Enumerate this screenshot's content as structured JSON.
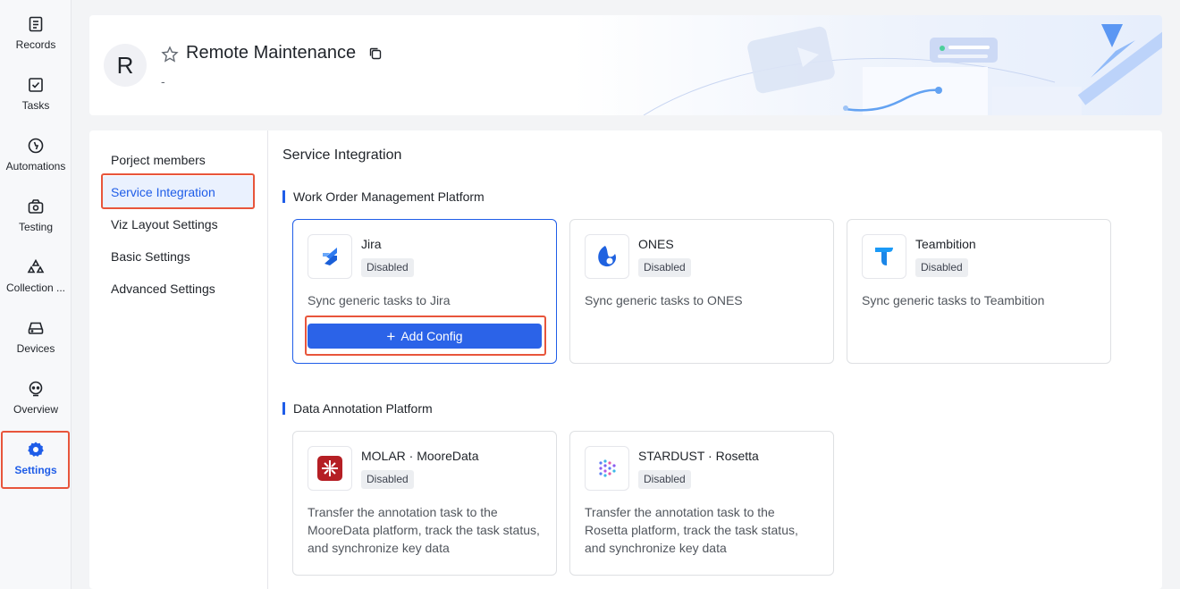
{
  "rail": {
    "items": [
      {
        "label": "Records",
        "icon": "records-icon"
      },
      {
        "label": "Tasks",
        "icon": "tasks-icon"
      },
      {
        "label": "Automations",
        "icon": "automations-icon"
      },
      {
        "label": "Testing",
        "icon": "testing-icon"
      },
      {
        "label": "Collection ...",
        "icon": "collection-icon"
      },
      {
        "label": "Devices",
        "icon": "devices-icon"
      },
      {
        "label": "Overview",
        "icon": "overview-icon"
      },
      {
        "label": "Settings",
        "icon": "settings-icon"
      }
    ],
    "active": "Settings"
  },
  "header": {
    "avatar_letter": "R",
    "title": "Remote Maintenance",
    "subtitle": "-"
  },
  "subnav": {
    "items": [
      "Porject members",
      "Service Integration",
      "Viz Layout Settings",
      "Basic Settings",
      "Advanced Settings"
    ],
    "active": "Service Integration"
  },
  "content": {
    "title": "Service Integration",
    "groups": [
      {
        "title": "Work Order Management Platform",
        "cards": [
          {
            "name": "Jira",
            "status": "Disabled",
            "description": "Sync generic tasks to Jira",
            "button": "Add Config",
            "logo": "jira-logo"
          },
          {
            "name": "ONES",
            "status": "Disabled",
            "description": "Sync generic tasks to ONES",
            "logo": "ones-logo"
          },
          {
            "name": "Teambition",
            "status": "Disabled",
            "description": "Sync generic tasks to Teambition",
            "logo": "teambition-logo"
          }
        ]
      },
      {
        "title": "Data Annotation Platform",
        "cards": [
          {
            "name": "MOLAR · MooreData",
            "status": "Disabled",
            "description": "Transfer the annotation task to the MooreData platform, track the task status, and synchronize key data",
            "logo": "molar-logo"
          },
          {
            "name": "STARDUST · Rosetta",
            "status": "Disabled",
            "description": "Transfer the annotation task to the Rosetta platform, track the task status, and synchronize key data",
            "logo": "stardust-logo"
          }
        ]
      }
    ]
  },
  "colors": {
    "accent": "#1f5de8",
    "highlight": "#e8553b",
    "button": "#2b63e8"
  }
}
